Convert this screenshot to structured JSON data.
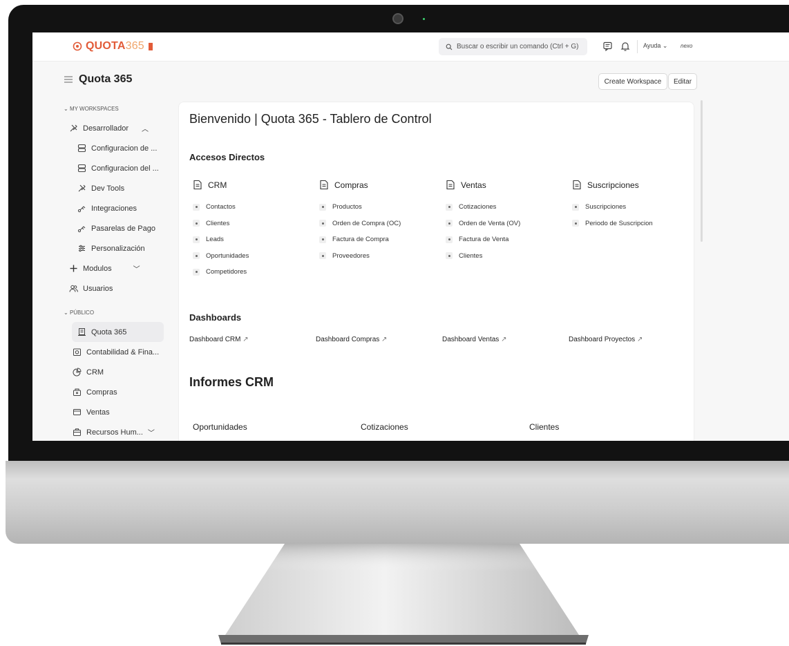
{
  "topbar": {
    "logo_bold": "QUOTA",
    "logo_num": "365",
    "search_placeholder": "Buscar o escribir un comando (Ctrl + G)",
    "help_label": "Ayuda",
    "user_label": "nexo"
  },
  "header": {
    "workspace_title": "Quota 365",
    "create_workspace": "Create Workspace",
    "edit": "Editar"
  },
  "sidebar": {
    "my_workspaces": "MY WORKSPACES",
    "dev": "Desarrollador",
    "dev_items": [
      {
        "label": "Configuracion de ...",
        "icon": "database-icon"
      },
      {
        "label": "Configuracion del ...",
        "icon": "database-icon"
      },
      {
        "label": "Dev Tools",
        "icon": "tools-icon"
      },
      {
        "label": "Integraciones",
        "icon": "plug-icon"
      },
      {
        "label": "Pasarelas de Pago",
        "icon": "plug-icon"
      },
      {
        "label": "Personalización",
        "icon": "sliders-icon"
      }
    ],
    "modulos": "Modulos",
    "usuarios": "Usuarios",
    "publico": "PÚBLICO",
    "public_items": [
      {
        "label": "Quota 365",
        "icon": "building-icon"
      },
      {
        "label": "Contabilidad & Fina...",
        "icon": "safe-icon"
      },
      {
        "label": "CRM",
        "icon": "chart-icon"
      },
      {
        "label": "Compras",
        "icon": "box-icon"
      },
      {
        "label": "Ventas",
        "icon": "card-icon"
      },
      {
        "label": "Recursos Hum...",
        "icon": "briefcase-icon"
      }
    ]
  },
  "main": {
    "title": "Bienvenido | Quota 365 - Tablero de Control",
    "shortcuts_heading": "Accesos Directos",
    "columns": [
      {
        "title": "CRM",
        "links": [
          "Contactos",
          "Clientes",
          "Leads",
          "Oportunidades",
          "Competidores"
        ]
      },
      {
        "title": "Compras",
        "links": [
          "Productos",
          "Orden de Compra (OC)",
          "Factura de Compra",
          "Proveedores"
        ]
      },
      {
        "title": "Ventas",
        "links": [
          "Cotizaciones",
          "Orden de Venta (OV)",
          "Factura de Venta",
          "Clientes"
        ]
      },
      {
        "title": "Suscripciones",
        "links": [
          "Suscripciones",
          "Periodo de Suscripcion"
        ]
      }
    ],
    "dashboards_heading": "Dashboards",
    "dashboards": [
      "Dashboard CRM",
      "Dashboard Compras",
      "Dashboard Ventas",
      "Dashboard Proyectos"
    ],
    "reports_heading": "Informes CRM",
    "reports": [
      "Oportunidades",
      "Cotizaciones",
      "Clientes"
    ]
  }
}
